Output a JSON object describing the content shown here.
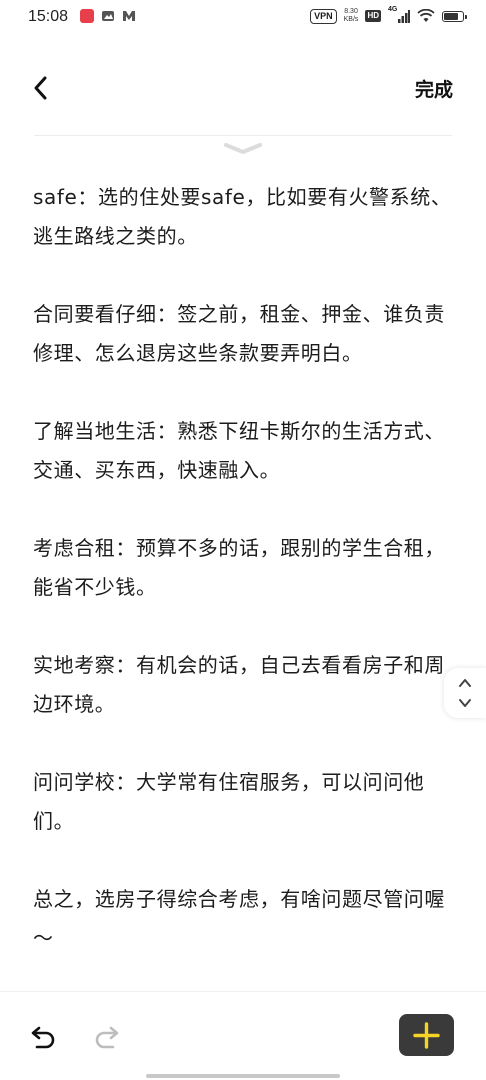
{
  "status_bar": {
    "time": "15:08",
    "vpn_label": "VPN",
    "net_speed_value": "8.30",
    "net_speed_unit": "KB/s",
    "hd_label": "HD",
    "signal_label": "4G",
    "battery_level": 0.85
  },
  "header": {
    "done_label": "完成"
  },
  "content": {
    "paragraphs": [
      "safe：选的住处要safe，比如要有火警系统、逃生路线之类的。",
      "合同要看仔细：签之前，租金、押金、谁负责修理、怎么退房这些条款要弄明白。",
      "了解当地生活：熟悉下纽卡斯尔的生活方式、交通、买东西，快速融入。",
      "考虑合租：预算不多的话，跟别的学生合租，能省不少钱。",
      "实地考察：有机会的话，自己去看看房子和周边环境。",
      "问问学校：大学常有住宿服务，可以问问他们。",
      "总之，选房子得综合考虑，有啥问题尽管问喔～"
    ]
  },
  "colors": {
    "add_button_bg": "#3a3a3a",
    "add_icon": "#f5d426",
    "text": "#1c1c1c"
  }
}
